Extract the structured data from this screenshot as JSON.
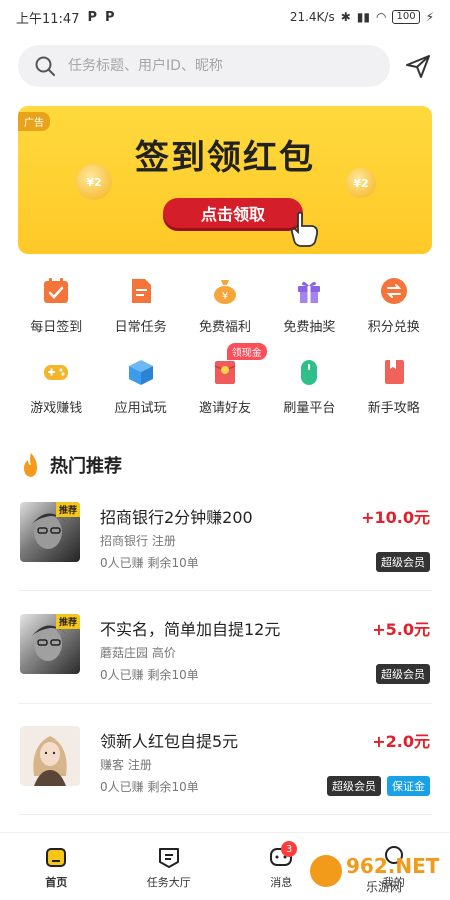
{
  "status": {
    "time": "上午11:47",
    "speed": "21.4K/s",
    "battery": "100"
  },
  "search": {
    "placeholder": "任务标题、用户ID、昵称"
  },
  "banner": {
    "ad_label": "广告",
    "title": "签到领红包",
    "cta": "点击领取",
    "coin_text": "¥2"
  },
  "features": [
    {
      "label": "每日签到",
      "icon": "calendar-check-icon",
      "color": "#f5743a"
    },
    {
      "label": "日常任务",
      "icon": "document-icon",
      "color": "#f5743a"
    },
    {
      "label": "免费福利",
      "icon": "money-bag-icon",
      "color": "#f5a53a"
    },
    {
      "label": "免费抽奖",
      "icon": "gift-icon",
      "color": "#8b63e6"
    },
    {
      "label": "积分兑换",
      "icon": "exchange-icon",
      "color": "#f5743a"
    },
    {
      "label": "游戏赚钱",
      "icon": "gamepad-icon",
      "color": "#f5b52a"
    },
    {
      "label": "应用试玩",
      "icon": "cube-icon",
      "color": "#3d9be9"
    },
    {
      "label": "邀请好友",
      "icon": "red-envelope-icon",
      "color": "#f05a5a",
      "badge": "领现金"
    },
    {
      "label": "刷量平台",
      "icon": "mouse-icon",
      "color": "#2fbf8a"
    },
    {
      "label": "新手攻略",
      "icon": "book-icon",
      "color": "#f0625a"
    }
  ],
  "hot": {
    "title": "热门推荐"
  },
  "tasks": [
    {
      "title": "招商银行2分钟赚200",
      "sub": "招商银行  注册",
      "meta": "0人已赚  剩余10单",
      "price": "+10.0元",
      "badge": "推荐",
      "tags": [
        "超级会员"
      ]
    },
    {
      "title": "不实名，简单加自提12元",
      "sub": "蘑菇庄园  高价",
      "meta": "0人已赚  剩余10单",
      "price": "+5.0元",
      "badge": "推荐",
      "tags": [
        "超级会员"
      ]
    },
    {
      "title": "领新人红包自提5元",
      "sub": "赚客  注册",
      "meta": "0人已赚  剩余10单",
      "price": "+2.0元",
      "badge": "",
      "tags": [
        "超级会员",
        "保证金"
      ]
    }
  ],
  "nav": [
    {
      "label": "首页",
      "icon": "home-icon",
      "active": true
    },
    {
      "label": "任务大厅",
      "icon": "task-hall-icon"
    },
    {
      "label": "消息",
      "icon": "message-icon",
      "badge": "3"
    },
    {
      "label": "我的",
      "icon": "profile-icon"
    }
  ],
  "watermark": {
    "text": "962.NET",
    "sub": "乐游网"
  }
}
